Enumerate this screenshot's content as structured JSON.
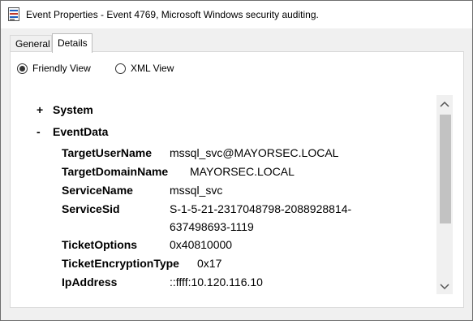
{
  "window": {
    "title": "Event Properties - Event 4769, Microsoft Windows security auditing."
  },
  "tabs": [
    {
      "label": "General",
      "selected": false
    },
    {
      "label": "Details",
      "selected": true
    }
  ],
  "view_options": {
    "friendly_label": "Friendly View",
    "xml_label": "XML View",
    "selected": "Friendly View"
  },
  "tree": {
    "system": {
      "toggle": "+",
      "label": "System"
    },
    "eventdata": {
      "toggle": "-",
      "label": "EventData"
    }
  },
  "fields": [
    {
      "name": "TargetUserName",
      "value": "mssql_svc@MAYORSEC.LOCAL"
    },
    {
      "name": "TargetDomainName",
      "value": "MAYORSEC.LOCAL"
    },
    {
      "name": "ServiceName",
      "value": "mssql_svc"
    },
    {
      "name": "ServiceSid",
      "value": "S-1-5-21-2317048798-2088928814-",
      "value_line2": "637498693-1119"
    },
    {
      "name": "TicketOptions",
      "value": "0x40810000"
    },
    {
      "name": "TicketEncryptionType",
      "value": "0x17"
    },
    {
      "name": "IpAddress",
      "value": "::ffff:10.120.116.10"
    }
  ],
  "icons": {
    "app": "event-viewer-icon",
    "scroll_up": "chevron-up-icon",
    "scroll_down": "chevron-down-icon"
  }
}
